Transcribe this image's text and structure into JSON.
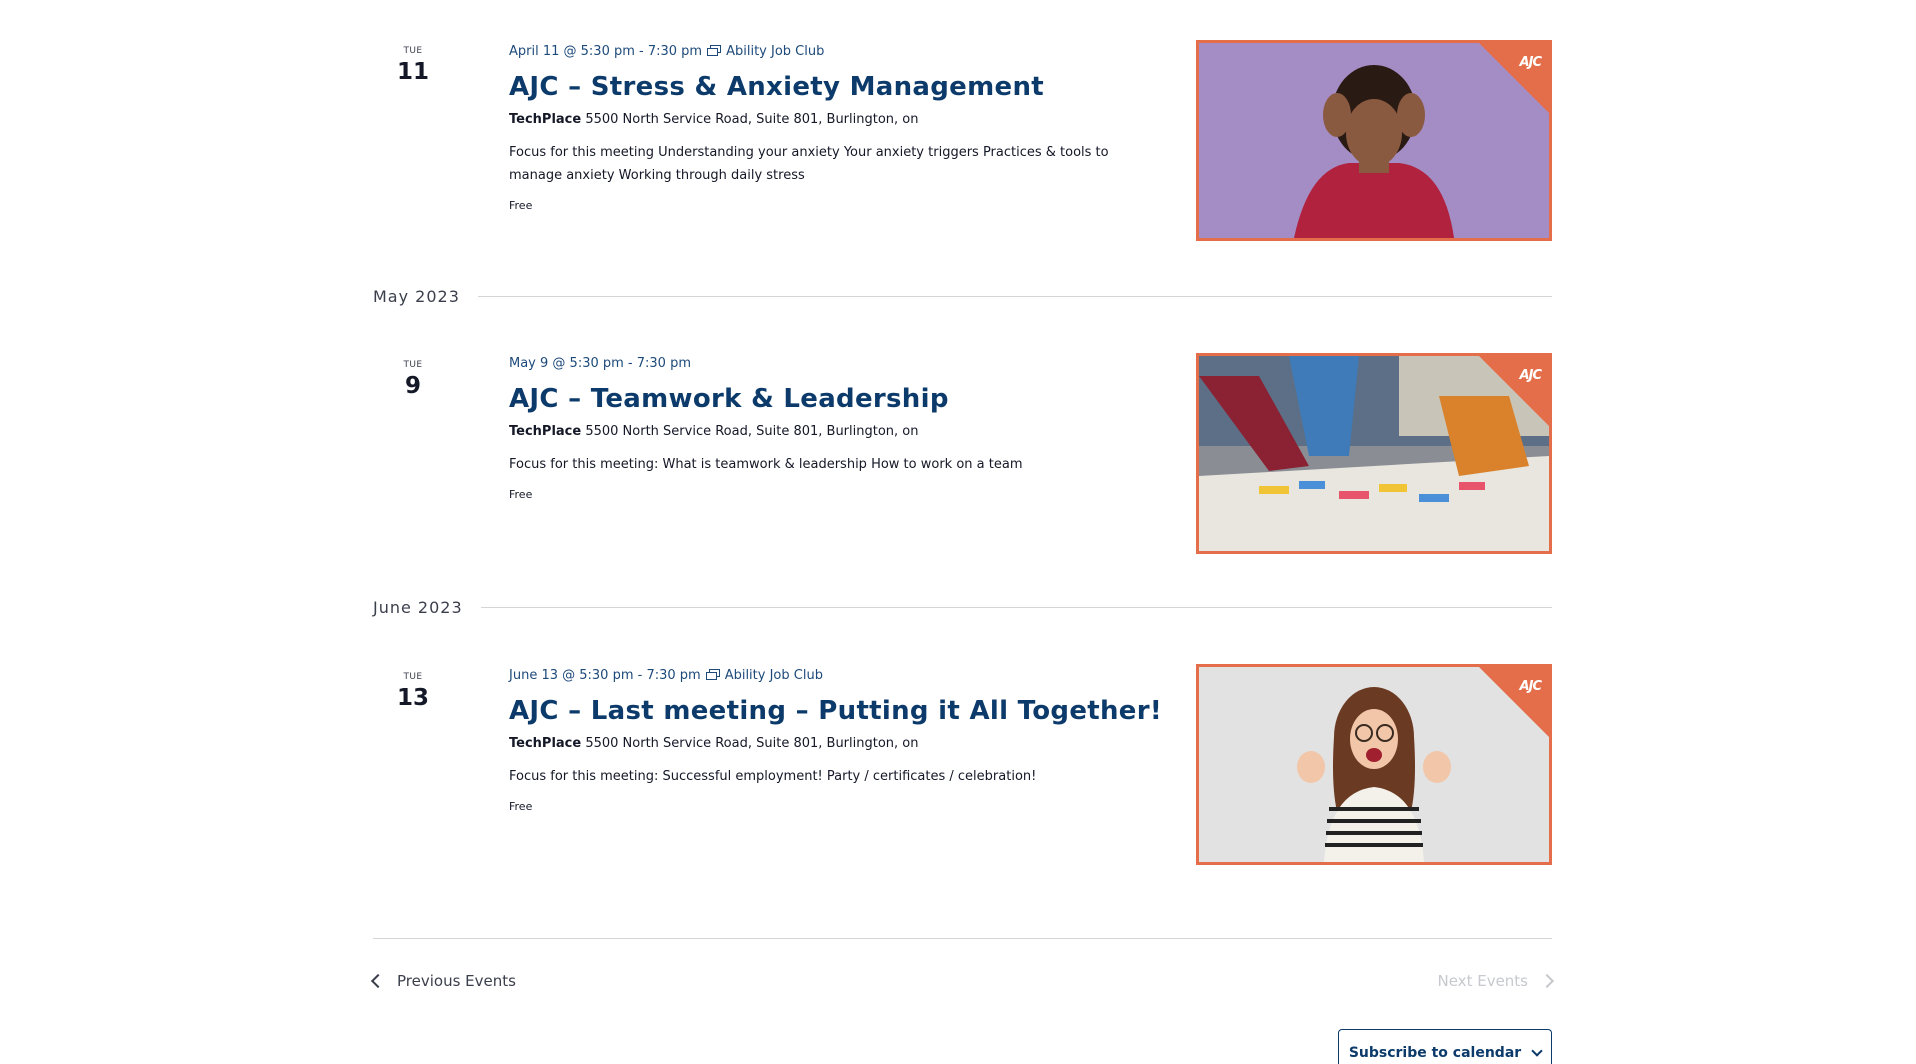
{
  "events": [
    {
      "dow": "TUE",
      "day": "11",
      "datetime": "April 11 @ 5:30 pm - 7:30 pm",
      "series": "Ability Job Club",
      "title": "AJC – Stress & Anxiety Management",
      "venue_name": "TechPlace",
      "venue_address": "5500 North Service Road, Suite 801, Burlington, on",
      "description": "Focus for this meeting Understanding your anxiety Your anxiety triggers Practices & tools to manage anxiety Working through daily stress",
      "cost": "Free",
      "image_logo": "AJC"
    },
    {
      "dow": "TUE",
      "day": "9",
      "datetime": "May 9 @ 5:30 pm - 7:30 pm",
      "series": "",
      "title": "AJC – Teamwork & Leadership",
      "venue_name": "TechPlace",
      "venue_address": "5500 North Service Road, Suite 801, Burlington, on",
      "description": "Focus for this meeting: What is teamwork & leadership How to work on a team",
      "cost": "Free",
      "image_logo": "AJC"
    },
    {
      "dow": "TUE",
      "day": "13",
      "datetime": "June 13 @ 5:30 pm - 7:30 pm",
      "series": "Ability Job Club",
      "title": "AJC – Last meeting – Putting it All Together!",
      "venue_name": "TechPlace",
      "venue_address": "5500 North Service Road, Suite 801, Burlington, on",
      "description": "Focus for this meeting: Successful employment! Party / certificates / celebration!",
      "cost": "Free",
      "image_logo": "AJC"
    }
  ],
  "months": [
    "May 2023",
    "June 2023"
  ],
  "nav": {
    "previous": "Previous Events",
    "next": "Next Events"
  },
  "subscribe": "Subscribe to calendar",
  "colors": {
    "accent": "#e46e4a",
    "title": "#0c3b6b",
    "link": "#1d4a7a"
  }
}
